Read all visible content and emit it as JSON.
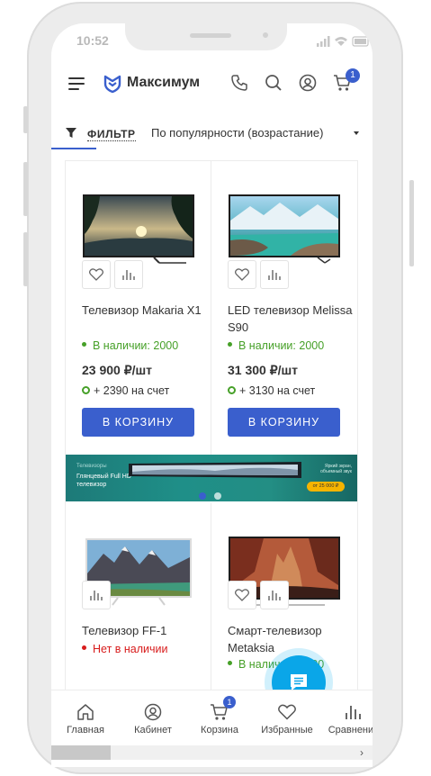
{
  "status": {
    "time": "10:52"
  },
  "header": {
    "logo_text": "Максимум",
    "cart_count": "1"
  },
  "filter": {
    "label": "ФИЛЬТР",
    "sort": "По популярности (возрастание)"
  },
  "products": [
    {
      "title": "Телевизор Makaria X1",
      "stock": "В наличии: 2000",
      "price": "23 900 ₽/шт",
      "bonus": "+ 2390 на счет",
      "button": "В КОРЗИНУ"
    },
    {
      "title": "LED телевизор Melissa S90",
      "stock": "В наличии: 2000",
      "price": "31 300 ₽/шт",
      "bonus": "+ 3130 на счет",
      "button": "В КОРЗИНУ"
    },
    {
      "title": "Телевизор FF-1",
      "stock": "Нет в наличии"
    },
    {
      "title": "Смарт-телевизор Metaksia",
      "stock": "В наличии: 2000"
    }
  ],
  "banner": {
    "small": "Телевизоры",
    "main": "Глянцевый Full HD телевизор",
    "right": "Яркий экран, объемный звук",
    "price": "от 25 000 ₽"
  },
  "bottom_nav": [
    {
      "label": "Главная",
      "icon": "home-icon"
    },
    {
      "label": "Кабинет",
      "icon": "user-icon"
    },
    {
      "label": "Корзина",
      "icon": "cart-icon",
      "badge": "1"
    },
    {
      "label": "Избранные",
      "icon": "heart-icon"
    },
    {
      "label": "Сравнение",
      "icon": "compare-icon"
    }
  ],
  "colors": {
    "accent": "#3a5fcd",
    "in_stock": "#46a028",
    "out_of_stock": "#d81c1c",
    "chat": "#0aa6e8"
  }
}
